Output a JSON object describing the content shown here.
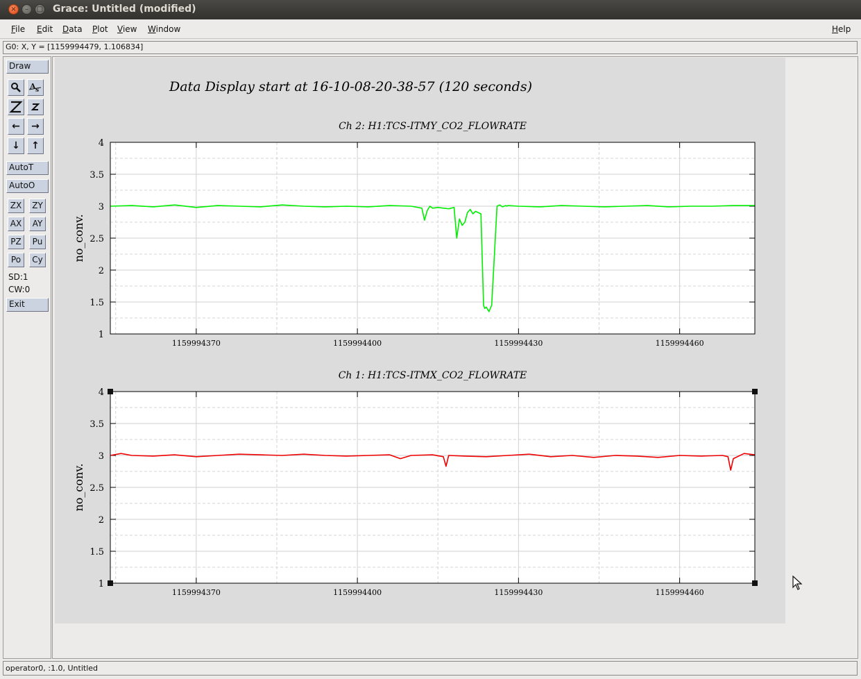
{
  "window": {
    "title": "Grace: Untitled (modified)"
  },
  "menubar": {
    "items": [
      {
        "label": "File",
        "u": "F",
        "rest": "ile"
      },
      {
        "label": "Edit",
        "u": "E",
        "rest": "dit"
      },
      {
        "label": "Data",
        "u": "D",
        "rest": "ata"
      },
      {
        "label": "Plot",
        "u": "P",
        "rest": "lot"
      },
      {
        "label": "View",
        "u": "V",
        "rest": "iew"
      },
      {
        "label": "Window",
        "u": "W",
        "rest": "indow"
      }
    ],
    "help": {
      "label": "Help",
      "u": "H",
      "rest": "elp"
    }
  },
  "locator": {
    "text": "G0: X, Y = [1159994479, 1.106834]"
  },
  "toolbar": {
    "draw": "Draw",
    "icons": [
      "zoom-icon",
      "text-as-icon",
      "zoom-in-z-icon",
      "zoom-out-z-icon",
      "arrow-left-icon",
      "arrow-right-icon",
      "arrow-down-icon",
      "arrow-up-icon"
    ],
    "autot": "AutoT",
    "autoo": "AutoO",
    "small_buttons": [
      "ZX",
      "ZY",
      "AX",
      "AY",
      "PZ",
      "Pu",
      "Po",
      "Cy"
    ],
    "sd": "SD:1",
    "cw": "CW:0",
    "exit": "Exit",
    "glyphs": {
      "left": "←",
      "right": "→",
      "down": "↓",
      "up": "↑"
    }
  },
  "status": {
    "text": "operator0, :1.0, Untitled"
  },
  "plot": {
    "main_title": "Data Display start at 16-10-08-20-38-57 (120 seconds)"
  },
  "chart_data": [
    {
      "type": "line",
      "title": "Ch 2: H1:TCS-ITMY_CO2_FLOWRATE",
      "ylabel": "no_conv.",
      "xlabel": "",
      "xlim": [
        1159994354,
        1159994474
      ],
      "ylim": [
        1,
        4
      ],
      "xticks": [
        1159994370,
        1159994400,
        1159994430,
        1159994460
      ],
      "xtick_labels": [
        "1159994370",
        "1159994400",
        "1159994430",
        "1159994460"
      ],
      "yticks": [
        1,
        1.5,
        2,
        2.5,
        3,
        3.5,
        4
      ],
      "ytick_labels": [
        "1",
        "1.5",
        "2",
        "2.5",
        "3",
        "3.5",
        "4"
      ],
      "grid": true,
      "series": [
        {
          "color": "#00ee00",
          "x": [
            1159994354,
            1159994358,
            1159994362,
            1159994366,
            1159994370,
            1159994374,
            1159994378,
            1159994382,
            1159994386,
            1159994390,
            1159994394,
            1159994398,
            1159994402,
            1159994406,
            1159994410,
            1159994412,
            1159994412.5,
            1159994413,
            1159994413.5,
            1159994414,
            1159994415,
            1159994417,
            1159994418,
            1159994418.5,
            1159994419,
            1159994419.5,
            1159994420,
            1159994420.5,
            1159994421,
            1159994421.5,
            1159994422,
            1159994423,
            1159994423.5,
            1159994423.7,
            1159994424,
            1159994424.5,
            1159994425,
            1159994426,
            1159994426.5,
            1159994427,
            1159994427.3,
            1159994427.6,
            1159994427.8,
            1159994428,
            1159994430,
            1159994434,
            1159994438,
            1159994442,
            1159994446,
            1159994450,
            1159994454,
            1159994458,
            1159994462,
            1159994466,
            1159994470,
            1159994474
          ],
          "y": [
            3.0,
            3.01,
            2.99,
            3.02,
            2.98,
            3.01,
            3.0,
            2.99,
            3.02,
            3.0,
            2.99,
            3.0,
            2.99,
            3.01,
            3.0,
            2.97,
            2.78,
            2.93,
            3.0,
            2.97,
            2.98,
            2.96,
            2.98,
            2.5,
            2.8,
            2.7,
            2.75,
            2.9,
            2.95,
            2.88,
            2.92,
            2.88,
            1.45,
            1.4,
            1.42,
            1.35,
            1.45,
            3.0,
            3.02,
            2.99,
            3.0,
            3.01,
            3.0,
            3.01,
            3.0,
            2.99,
            3.01,
            3.0,
            2.99,
            3.0,
            3.01,
            2.99,
            3.0,
            3.0,
            3.01,
            3.01
          ]
        }
      ]
    },
    {
      "type": "line",
      "title": "Ch 1: H1:TCS-ITMX_CO2_FLOWRATE",
      "ylabel": "no_conv.",
      "xlabel": "",
      "xlim": [
        1159994354,
        1159994474
      ],
      "ylim": [
        1,
        4
      ],
      "xticks": [
        1159994370,
        1159994400,
        1159994430,
        1159994460
      ],
      "xtick_labels": [
        "1159994370",
        "1159994400",
        "1159994430",
        "1159994460"
      ],
      "yticks": [
        1,
        1.5,
        2,
        2.5,
        3,
        3.5,
        4
      ],
      "ytick_labels": [
        "1",
        "1.5",
        "2",
        "2.5",
        "3",
        "3.5",
        "4"
      ],
      "grid": true,
      "series": [
        {
          "color": "#ee0000",
          "x": [
            1159994354,
            1159994356,
            1159994358,
            1159994362,
            1159994366,
            1159994370,
            1159994374,
            1159994378,
            1159994382,
            1159994386,
            1159994390,
            1159994394,
            1159994398,
            1159994402,
            1159994406,
            1159994408,
            1159994410,
            1159994414,
            1159994416,
            1159994416.5,
            1159994417,
            1159994420,
            1159994424,
            1159994428,
            1159994432,
            1159994436,
            1159994440,
            1159994444,
            1159994448,
            1159994452,
            1159994456,
            1159994460,
            1159994464,
            1159994468,
            1159994469,
            1159994469.5,
            1159994470,
            1159994472,
            1159994474
          ],
          "y": [
            3.0,
            3.03,
            3.0,
            2.99,
            3.01,
            2.98,
            3.0,
            3.02,
            3.01,
            3.0,
            3.02,
            3.0,
            2.99,
            3.0,
            3.01,
            2.95,
            3.0,
            3.01,
            2.98,
            2.83,
            3.0,
            2.99,
            2.98,
            3.0,
            3.02,
            2.98,
            3.0,
            2.97,
            3.0,
            2.99,
            2.97,
            3.0,
            2.99,
            3.0,
            2.98,
            2.77,
            2.95,
            3.03,
            3.01
          ]
        }
      ]
    }
  ]
}
